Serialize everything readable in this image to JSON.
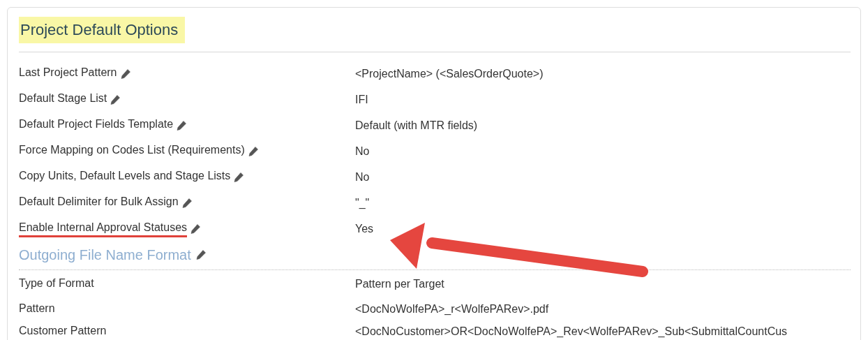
{
  "title": {
    "text": "Project Default Options",
    "highlighted": true
  },
  "rows": [
    {
      "label": "Last Project Pattern",
      "editable": true,
      "value": "<ProjectName> (<SalesOrderQuote>)",
      "marked": false
    },
    {
      "label": "Default Stage List",
      "editable": true,
      "value": "IFI",
      "marked": false
    },
    {
      "label": "Default Project Fields Template",
      "editable": true,
      "value": "Default (with MTR fields)",
      "marked": false
    },
    {
      "label": "Force Mapping on Codes List (Requirements)",
      "editable": true,
      "value": "No",
      "marked": false
    },
    {
      "label": "Copy Units, Default Levels and Stage Lists",
      "editable": true,
      "value": "No",
      "marked": false
    },
    {
      "label": "Default Delimiter for Bulk Assign",
      "editable": true,
      "value": "\"_\"",
      "marked": false
    },
    {
      "label": "Enable Internal Approval Statuses",
      "editable": true,
      "value": "Yes",
      "marked": true
    }
  ],
  "section": {
    "title": "Outgoing File Name Format",
    "editable": true,
    "rows": [
      {
        "label": "Type of Format",
        "value": "Pattern per Target"
      },
      {
        "label": "Pattern",
        "value": "<DocNoWolfePA>_r<WolfePARev>.pdf"
      },
      {
        "label": "Customer Pattern",
        "value": "<DocNoCustomer>OR<DocNoWolfePA>_Rev<WolfePARev>_Sub<SubmittalCountCus"
      }
    ]
  }
}
